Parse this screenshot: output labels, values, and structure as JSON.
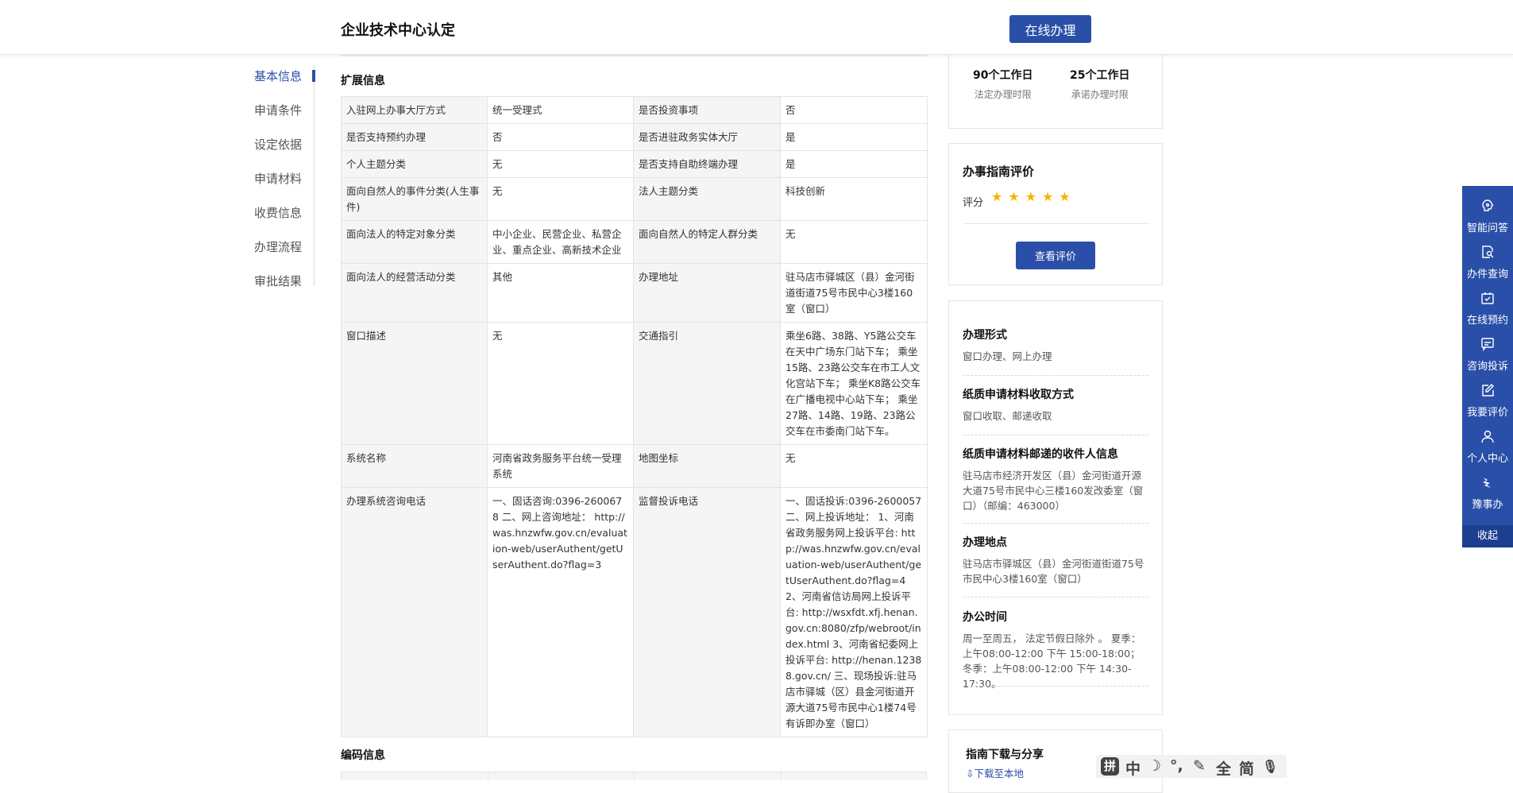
{
  "header": {
    "title": "企业技术中心认定",
    "online_button": "在线办理"
  },
  "leftnav": [
    {
      "label": "基本信息",
      "active": true
    },
    {
      "label": "申请条件",
      "active": false
    },
    {
      "label": "设定依据",
      "active": false
    },
    {
      "label": "申请材料",
      "active": false
    },
    {
      "label": "收费信息",
      "active": false
    },
    {
      "label": "办理流程",
      "active": false
    },
    {
      "label": "审批结果",
      "active": false
    }
  ],
  "ext": {
    "title": "扩展信息",
    "rows": [
      [
        "入驻网上办事大厅方式",
        "统一受理式",
        "是否投资事项",
        "否"
      ],
      [
        "是否支持预约办理",
        "否",
        "是否进驻政务实体大厅",
        "是"
      ],
      [
        "个人主题分类",
        "无",
        "是否支持自助终端办理",
        "是"
      ],
      [
        "面向自然人的事件分类(人生事件)",
        "无",
        "法人主题分类",
        "科技创新"
      ],
      [
        "面向法人的特定对象分类",
        "中小企业、民营企业、私营企业、重点企业、高新技术企业",
        "面向自然人的特定人群分类",
        "无"
      ],
      [
        "面向法人的经营活动分类",
        "其他",
        "办理地址",
        "驻马店市驿城区（县）金河街道街道75号市民中心3楼160室（窗口）"
      ],
      [
        "窗口描述",
        "无",
        "交通指引",
        "乘坐6路、38路、Y5路公交车在天中广场东门站下车； 乘坐15路、23路公交车在市工人文化宫站下车； 乘坐K8路公交车在广播电视中心站下车； 乘坐27路、14路、19路、23路公交车在市委南门站下车。"
      ],
      [
        "系统名称",
        "河南省政务服务平台统一受理系统",
        "地图坐标",
        "无"
      ],
      [
        "办理系统咨询电话",
        "一、固话咨询:0396-2600678 二、网上咨询地址： http://was.hnzwfw.gov.cn/evaluation-web/userAuthent/getUserAuthent.do?flag=3",
        "监督投诉电话",
        "一、固话投诉:0396-2600057 二、网上投诉地址： 1、河南省政务服务网上投诉平台: http://was.hnzwfw.gov.cn/evaluation-web/userAuthent/getUserAuthent.do?flag=4 2、河南省信访局网上投诉平台: http://wsxfdt.xfj.henan.gov.cn:8080/zfp/webroot/index.html 3、河南省纪委网上投诉平台: http://henan.12388.gov.cn/ 三、现场投诉:驻马店市驿城（区）县金河街道开源大道75号市民中心1楼74号有诉即办室（窗口）"
      ]
    ]
  },
  "encoding": {
    "title": "编码信息"
  },
  "time_card": {
    "legal": {
      "value": "90个工作日",
      "label": "法定办理时限"
    },
    "promise": {
      "value": "25个工作日",
      "label": "承诺办理时限"
    }
  },
  "rating": {
    "title": "办事指南评价",
    "score_label": "评分",
    "stars": "★★★★★",
    "button": "查看评价"
  },
  "info": [
    {
      "title": "办理形式",
      "value": "窗口办理、网上办理"
    },
    {
      "title": "纸质申请材料收取方式",
      "value": "窗口收取、邮递收取"
    },
    {
      "title": "纸质申请材料邮递的收件人信息",
      "value": "驻马店市经济开发区（县）金河街道开源大道75号市民中心三楼160发改委室（窗口）（邮编：463000）"
    },
    {
      "title": "办理地点",
      "value": "驻马店市驿城区（县）金河街道街道75号市民中心3楼160室（窗口）"
    },
    {
      "title": "办公时间",
      "value": "周一至周五， 法定节假日除外 。 夏季：上午08:00-12:00 下午 15:00-18:00； 冬季：上午08:00-12:00 下午 14:30-17:30。"
    }
  ],
  "download": {
    "title": "指南下载与分享",
    "link": "⇩下载至本地"
  },
  "sidebar": {
    "items": [
      {
        "label": "智能问答",
        "icon": "brain-icon"
      },
      {
        "label": "办件查询",
        "icon": "document-search-icon"
      },
      {
        "label": "在线预约",
        "icon": "calendar-check-icon"
      },
      {
        "label": "咨询投诉",
        "icon": "chat-icon"
      },
      {
        "label": "我要评价",
        "icon": "edit-icon"
      },
      {
        "label": "个人中心",
        "icon": "user-icon"
      },
      {
        "label": "豫事办",
        "icon": "app-logo-icon"
      }
    ],
    "collapse": "收起"
  },
  "ime": {
    "items": [
      "拼",
      "中",
      "☽",
      "°,",
      "✎",
      "全",
      "简",
      "🎙"
    ]
  }
}
